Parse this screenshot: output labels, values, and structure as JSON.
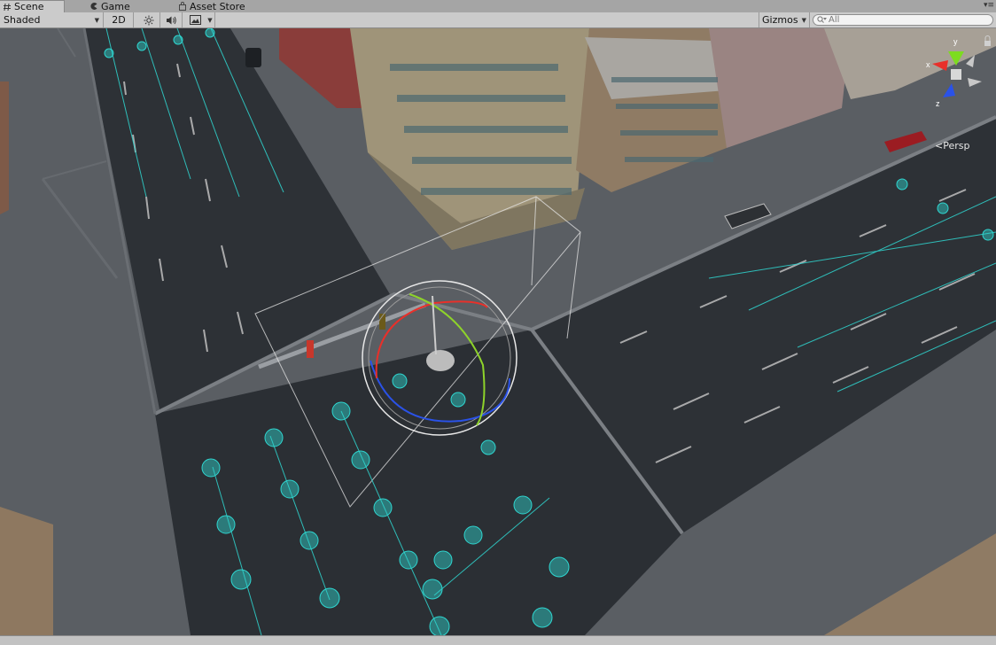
{
  "tabs": [
    {
      "label": "Scene",
      "icon": "hash-icon",
      "active": true
    },
    {
      "label": "Game",
      "icon": "pacman-icon",
      "active": false
    },
    {
      "label": "Asset Store",
      "icon": "store-bag-icon",
      "active": false
    }
  ],
  "toolbar": {
    "shading_mode": "Shaded",
    "mode_2d_label": "2D",
    "lighting_icon": "sun-icon",
    "audio_icon": "speaker-icon",
    "effects_icon": "image-icon",
    "gizmos_label": "Gizmos",
    "search_placeholder": "All"
  },
  "scene_view": {
    "projection_label": "Persp",
    "orientation_gizmo": {
      "y_label": "y",
      "x_label": "x",
      "z_label": "z"
    }
  },
  "colors": {
    "accent_cyan": "#2fd6d0",
    "axis_x": "#e8302a",
    "axis_y": "#8ed32a",
    "axis_z": "#2a52e8"
  }
}
